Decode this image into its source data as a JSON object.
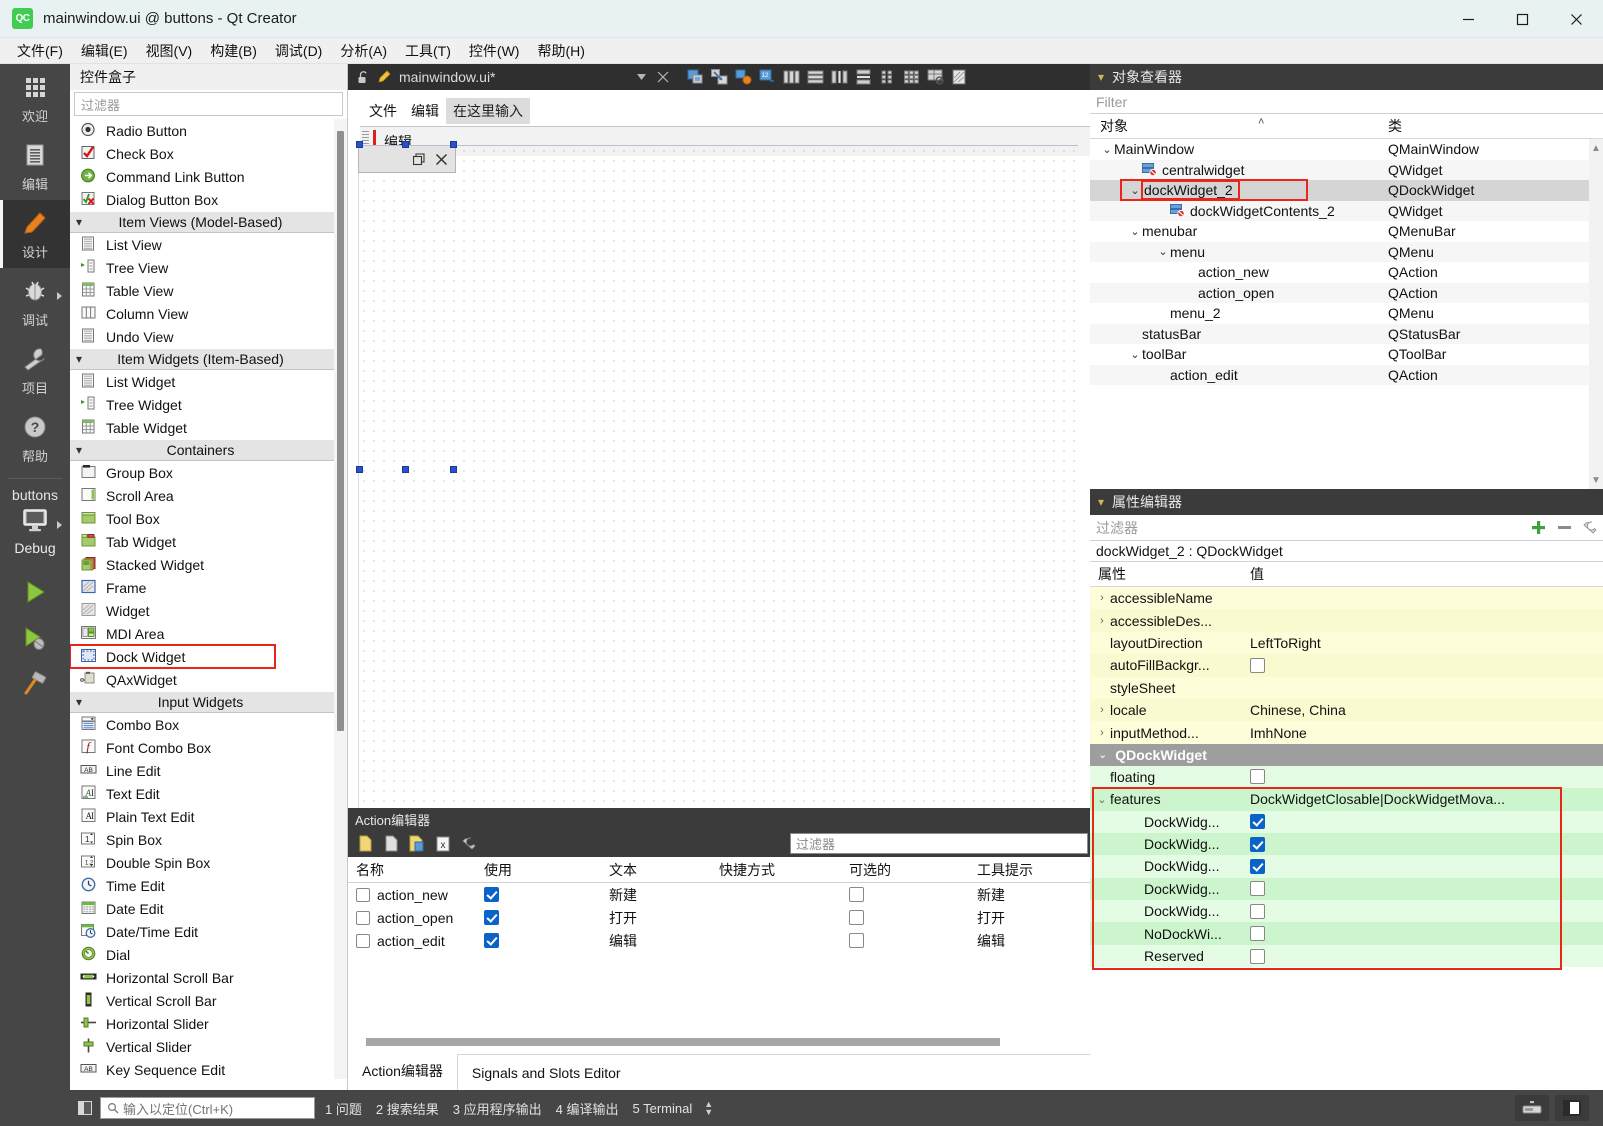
{
  "window": {
    "title": "mainwindow.ui @ buttons - Qt Creator",
    "logo_text": "QC",
    "minimize": "─",
    "maximize": "□",
    "close": "✕"
  },
  "menubar": {
    "items": [
      {
        "label": "文件(F)",
        "name": "menu-file"
      },
      {
        "label": "编辑(E)",
        "name": "menu-edit"
      },
      {
        "label": "视图(V)",
        "name": "menu-view"
      },
      {
        "label": "构建(B)",
        "name": "menu-build"
      },
      {
        "label": "调试(D)",
        "name": "menu-debug"
      },
      {
        "label": "分析(A)",
        "name": "menu-analyze"
      },
      {
        "label": "工具(T)",
        "name": "menu-tools"
      },
      {
        "label": "控件(W)",
        "name": "menu-widgets"
      },
      {
        "label": "帮助(H)",
        "name": "menu-help"
      }
    ]
  },
  "modebar": {
    "modes": [
      {
        "label": "欢迎",
        "icon": "grid-icon",
        "active": false,
        "arrow": false
      },
      {
        "label": "编辑",
        "icon": "document-icon",
        "active": false,
        "arrow": false
      },
      {
        "label": "设计",
        "icon": "pencil-icon",
        "active": true,
        "arrow": false
      },
      {
        "label": "调试",
        "icon": "bug-icon",
        "active": false,
        "arrow": true
      },
      {
        "label": "项目",
        "icon": "wrench-icon",
        "active": false,
        "arrow": false
      },
      {
        "label": "帮助",
        "icon": "help-icon",
        "active": false,
        "arrow": false
      }
    ],
    "kit_project": "buttons",
    "kit_config": "Debug",
    "kit_icon": "monitor-icon",
    "run_buttons": [
      "run-icon",
      "debug-run-icon",
      "build-hammer-icon"
    ]
  },
  "widgetbox": {
    "title": "控件盒子",
    "filter_placeholder": "过滤器",
    "items": [
      {
        "type": "item",
        "label": "Radio Button",
        "icon": "radio-button-icon"
      },
      {
        "type": "item",
        "label": "Check Box",
        "icon": "check-box-icon"
      },
      {
        "type": "item",
        "label": "Command Link Button",
        "icon": "command-link-icon"
      },
      {
        "type": "item",
        "label": "Dialog Button Box",
        "icon": "dialog-button-box-icon"
      },
      {
        "type": "group",
        "label": "Item Views (Model-Based)"
      },
      {
        "type": "item",
        "label": "List View",
        "icon": "list-view-icon"
      },
      {
        "type": "item",
        "label": "Tree View",
        "icon": "tree-view-icon"
      },
      {
        "type": "item",
        "label": "Table View",
        "icon": "table-view-icon"
      },
      {
        "type": "item",
        "label": "Column View",
        "icon": "column-view-icon"
      },
      {
        "type": "item",
        "label": "Undo View",
        "icon": "undo-view-icon"
      },
      {
        "type": "group",
        "label": "Item Widgets (Item-Based)"
      },
      {
        "type": "item",
        "label": "List Widget",
        "icon": "list-widget-icon"
      },
      {
        "type": "item",
        "label": "Tree Widget",
        "icon": "tree-widget-icon"
      },
      {
        "type": "item",
        "label": "Table Widget",
        "icon": "table-widget-icon"
      },
      {
        "type": "group",
        "label": "Containers"
      },
      {
        "type": "item",
        "label": "Group Box",
        "icon": "group-box-icon"
      },
      {
        "type": "item",
        "label": "Scroll Area",
        "icon": "scroll-area-icon"
      },
      {
        "type": "item",
        "label": "Tool Box",
        "icon": "tool-box-icon"
      },
      {
        "type": "item",
        "label": "Tab Widget",
        "icon": "tab-widget-icon"
      },
      {
        "type": "item",
        "label": "Stacked Widget",
        "icon": "stacked-widget-icon"
      },
      {
        "type": "item",
        "label": "Frame",
        "icon": "frame-icon"
      },
      {
        "type": "item",
        "label": "Widget",
        "icon": "widget-icon"
      },
      {
        "type": "item",
        "label": "MDI Area",
        "icon": "mdi-area-icon"
      },
      {
        "type": "item",
        "label": "Dock Widget",
        "icon": "dock-widget-icon",
        "highlighted": true
      },
      {
        "type": "item",
        "label": "QAxWidget",
        "icon": "qax-widget-icon"
      },
      {
        "type": "group",
        "label": "Input Widgets"
      },
      {
        "type": "item",
        "label": "Combo Box",
        "icon": "combo-box-icon"
      },
      {
        "type": "item",
        "label": "Font Combo Box",
        "icon": "font-combo-box-icon"
      },
      {
        "type": "item",
        "label": "Line Edit",
        "icon": "line-edit-icon"
      },
      {
        "type": "item",
        "label": "Text Edit",
        "icon": "text-edit-icon"
      },
      {
        "type": "item",
        "label": "Plain Text Edit",
        "icon": "plain-text-edit-icon"
      },
      {
        "type": "item",
        "label": "Spin Box",
        "icon": "spin-box-icon"
      },
      {
        "type": "item",
        "label": "Double Spin Box",
        "icon": "double-spin-box-icon"
      },
      {
        "type": "item",
        "label": "Time Edit",
        "icon": "time-edit-icon"
      },
      {
        "type": "item",
        "label": "Date Edit",
        "icon": "date-edit-icon"
      },
      {
        "type": "item",
        "label": "Date/Time Edit",
        "icon": "date-time-edit-icon"
      },
      {
        "type": "item",
        "label": "Dial",
        "icon": "dial-icon"
      },
      {
        "type": "item",
        "label": "Horizontal Scroll Bar",
        "icon": "h-scrollbar-icon"
      },
      {
        "type": "item",
        "label": "Vertical Scroll Bar",
        "icon": "v-scrollbar-icon"
      },
      {
        "type": "item",
        "label": "Horizontal Slider",
        "icon": "h-slider-icon"
      },
      {
        "type": "item",
        "label": "Vertical Slider",
        "icon": "v-slider-icon"
      },
      {
        "type": "item",
        "label": "Key Sequence Edit",
        "icon": "key-sequence-edit-icon"
      }
    ]
  },
  "editor": {
    "filename": "mainwindow.ui*",
    "lock_icon": "unlocked-icon",
    "file_icon": "ui-file-icon",
    "dropdown_icon": "chevron-down-icon",
    "close_icon": "close-icon",
    "tools": [
      "edit-widgets-icon",
      "edit-signals-slots-icon",
      "edit-buddies-icon",
      "edit-tab-order-icon",
      "layout-horizontally-icon",
      "layout-vertically-icon",
      "layout-splitter-h-icon",
      "layout-splitter-v-icon",
      "layout-form-icon",
      "layout-grid-icon",
      "break-layout-icon",
      "adjust-size-icon"
    ]
  },
  "form": {
    "menu_items": [
      "文件",
      "编辑"
    ],
    "menu_placeholder": "在这里输入",
    "toolbar_label": "编辑",
    "dock_float_icon": "float-icon",
    "dock_close_icon": "close-icon"
  },
  "action_editor": {
    "title": "Action编辑器",
    "toolbar_icons": [
      "new-action-icon",
      "copy-action-icon",
      "paste-action-icon",
      "delete-action-icon",
      "configure-icon"
    ],
    "filter_placeholder": "过滤器",
    "columns": [
      "名称",
      "使用",
      "文本",
      "快捷方式",
      "可选的",
      "工具提示"
    ],
    "rows": [
      {
        "name": "action_new",
        "used": true,
        "text": "新建",
        "shortcut": "",
        "checkable": false,
        "tooltip": "新建"
      },
      {
        "name": "action_open",
        "used": true,
        "text": "打开",
        "shortcut": "",
        "checkable": false,
        "tooltip": "打开"
      },
      {
        "name": "action_edit",
        "used": true,
        "text": "编辑",
        "shortcut": "",
        "checkable": false,
        "tooltip": "编辑"
      }
    ],
    "tabs": [
      {
        "label": "Action编辑器",
        "active": true
      },
      {
        "label": "Signals and Slots Editor",
        "active": false
      }
    ]
  },
  "object_inspector": {
    "title": "对象查看器",
    "filter_placeholder": "Filter",
    "columns": [
      "对象",
      "类"
    ],
    "sort_indicator": "˄",
    "rows": [
      {
        "name": "MainWindow",
        "cls": "QMainWindow",
        "indent": 0,
        "chev": "⌄",
        "icon": "",
        "selected": false
      },
      {
        "name": "centralwidget",
        "cls": "QWidget",
        "indent": 1,
        "chev": "",
        "icon": "no-layout-icon",
        "selected": false
      },
      {
        "name": "dockWidget_2",
        "cls": "QDockWidget",
        "indent": 1,
        "chev": "⌄",
        "icon": "",
        "selected": true,
        "highlighted": true
      },
      {
        "name": "dockWidgetContents_2",
        "cls": "QWidget",
        "indent": 2,
        "chev": "",
        "icon": "no-layout-icon",
        "selected": false
      },
      {
        "name": "menubar",
        "cls": "QMenuBar",
        "indent": 1,
        "chev": "⌄",
        "icon": "",
        "selected": false
      },
      {
        "name": "menu",
        "cls": "QMenu",
        "indent": 2,
        "chev": "⌄",
        "icon": "",
        "selected": false
      },
      {
        "name": "action_new",
        "cls": "QAction",
        "indent": 3,
        "chev": "",
        "icon": "",
        "selected": false
      },
      {
        "name": "action_open",
        "cls": "QAction",
        "indent": 3,
        "chev": "",
        "icon": "",
        "selected": false
      },
      {
        "name": "menu_2",
        "cls": "QMenu",
        "indent": 2,
        "chev": "",
        "icon": "",
        "selected": false
      },
      {
        "name": "statusBar",
        "cls": "QStatusBar",
        "indent": 1,
        "chev": "",
        "icon": "",
        "selected": false
      },
      {
        "name": "toolBar",
        "cls": "QToolBar",
        "indent": 1,
        "chev": "⌄",
        "icon": "",
        "selected": false
      },
      {
        "name": "action_edit",
        "cls": "QAction",
        "indent": 2,
        "chev": "",
        "icon": "",
        "selected": false
      }
    ]
  },
  "property_editor": {
    "title": "属性编辑器",
    "filter_placeholder": "过滤器",
    "add_icon": "plus-icon",
    "remove_icon": "minus-icon",
    "configure_icon": "configure-icon",
    "object_line": "dockWidget_2 : QDockWidget",
    "columns": [
      "属性",
      "值"
    ],
    "rows": [
      {
        "name": "accessibleName",
        "value": "",
        "chev": "›",
        "band": "yellow1",
        "indent": 0,
        "type": "text"
      },
      {
        "name": "accessibleDes...",
        "value": "",
        "chev": "›",
        "band": "yellow2",
        "indent": 0,
        "type": "text"
      },
      {
        "name": "layoutDirection",
        "value": "LeftToRight",
        "chev": "",
        "band": "yellow1",
        "indent": 0,
        "type": "text"
      },
      {
        "name": "autoFillBackgr...",
        "value": "",
        "chev": "",
        "band": "yellow2",
        "indent": 0,
        "type": "checkbox",
        "checked": false
      },
      {
        "name": "styleSheet",
        "value": "",
        "chev": "",
        "band": "yellow1",
        "indent": 0,
        "type": "text"
      },
      {
        "name": "locale",
        "value": "Chinese, China",
        "chev": "›",
        "band": "yellow2",
        "indent": 0,
        "type": "text"
      },
      {
        "name": "inputMethod...",
        "value": "ImhNone",
        "chev": "›",
        "band": "yellow1",
        "indent": 0,
        "type": "text"
      }
    ],
    "group_label": "QDockWidget",
    "group_chev": "⌄",
    "dock_rows": [
      {
        "name": "floating",
        "value": "",
        "chev": "",
        "band": "green2",
        "indent": 0,
        "type": "checkbox",
        "checked": false,
        "in_highlight": false
      },
      {
        "name": "features",
        "value": "DockWidgetClosable|DockWidgetMova...",
        "chev": "⌄",
        "band": "green1",
        "indent": 0,
        "type": "text",
        "in_highlight": true
      },
      {
        "name": "DockWidg...",
        "value": "",
        "chev": "",
        "band": "green2",
        "indent": 1,
        "type": "checkbox",
        "checked": true,
        "in_highlight": true
      },
      {
        "name": "DockWidg...",
        "value": "",
        "chev": "",
        "band": "green1",
        "indent": 1,
        "type": "checkbox",
        "checked": true,
        "in_highlight": true
      },
      {
        "name": "DockWidg...",
        "value": "",
        "chev": "",
        "band": "green2",
        "indent": 1,
        "type": "checkbox",
        "checked": true,
        "in_highlight": true
      },
      {
        "name": "DockWidg...",
        "value": "",
        "chev": "",
        "band": "green1",
        "indent": 1,
        "type": "checkbox",
        "checked": false,
        "in_highlight": true
      },
      {
        "name": "DockWidg...",
        "value": "",
        "chev": "",
        "band": "green2",
        "indent": 1,
        "type": "checkbox",
        "checked": false,
        "in_highlight": true
      },
      {
        "name": "NoDockWi...",
        "value": "",
        "chev": "",
        "band": "green1",
        "indent": 1,
        "type": "checkbox",
        "checked": false,
        "in_highlight": true
      },
      {
        "name": "Reserved",
        "value": "",
        "chev": "",
        "band": "green2",
        "indent": 1,
        "type": "checkbox",
        "checked": false,
        "in_highlight": true
      }
    ]
  },
  "statusbar": {
    "locator_placeholder": "输入以定位(Ctrl+K)",
    "locator_icon": "search-icon",
    "output_panes": [
      {
        "num": "1",
        "label": "问题"
      },
      {
        "num": "2",
        "label": "搜索结果"
      },
      {
        "num": "3",
        "label": "应用程序输出"
      },
      {
        "num": "4",
        "label": "编译输出"
      },
      {
        "num": "5",
        "label": "Terminal"
      }
    ],
    "right_buttons": [
      "progress-icon",
      "sidebar-toggle-icon"
    ]
  },
  "colors": {
    "accent_red": "#e8261a",
    "highlight_green": "#cdf5cd",
    "highlight_yellow": "#fdfdd9",
    "checkbox_blue": "#0a64c8",
    "qt_green": "#41cd52"
  }
}
